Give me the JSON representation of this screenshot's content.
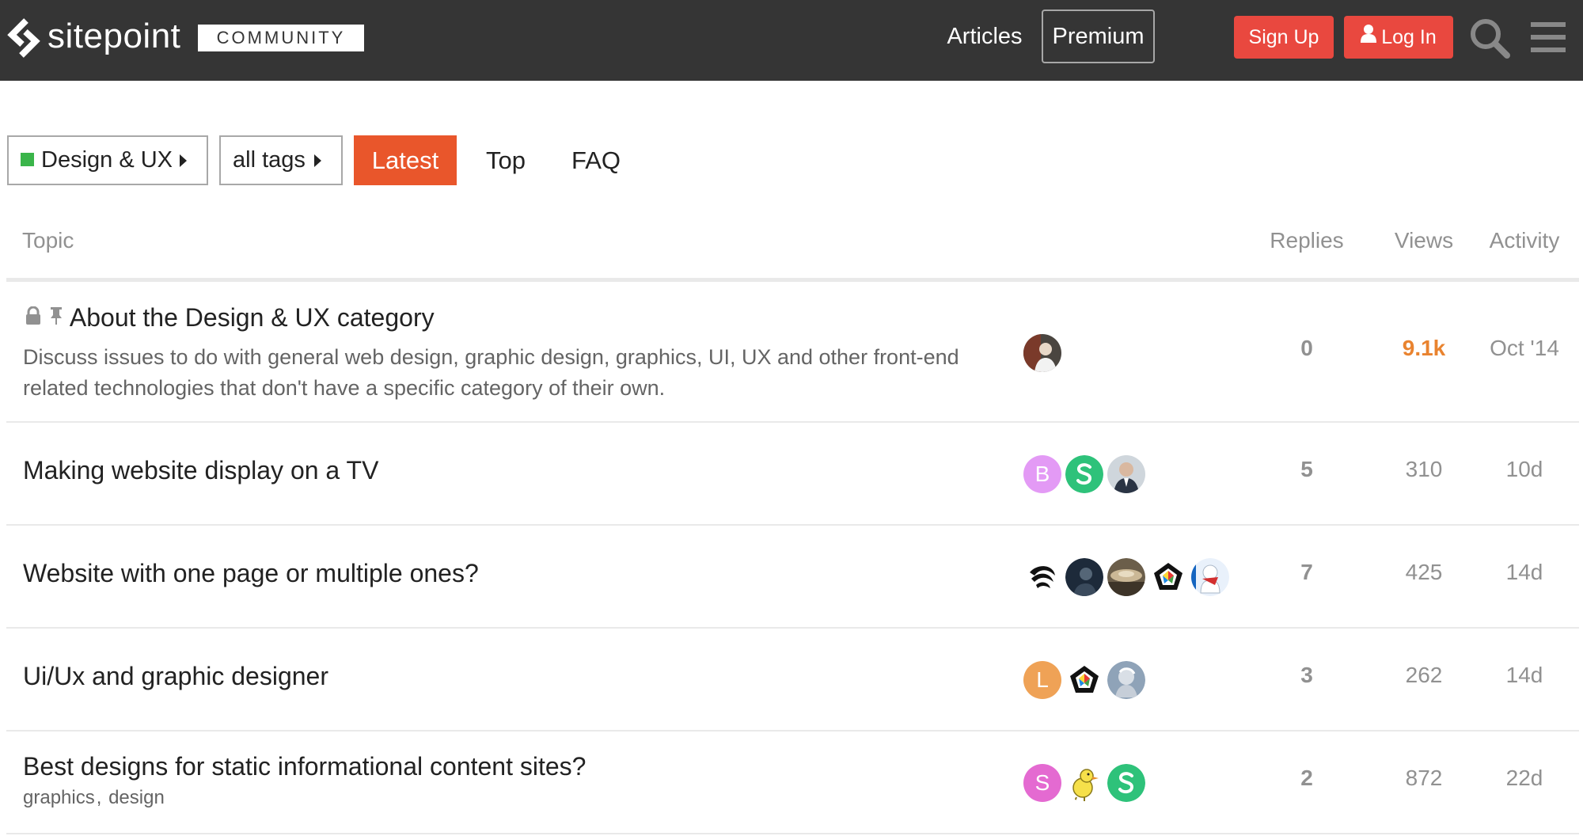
{
  "header": {
    "logo_text": "sitepoint",
    "community_label": "COMMUNITY",
    "nav": {
      "articles": "Articles",
      "premium": "Premium"
    },
    "signup_label": "Sign Up",
    "login_label": "Log In",
    "icons": [
      "logo-icon",
      "search-icon",
      "hamburger-menu-icon",
      "user-icon"
    ]
  },
  "filters": {
    "category": "Design & UX",
    "category_color": "#3ab54a",
    "tags": "all tags",
    "tabs": {
      "latest": "Latest",
      "top": "Top",
      "faq": "FAQ"
    }
  },
  "table": {
    "headers": {
      "topic": "Topic",
      "replies": "Replies",
      "views": "Views",
      "activity": "Activity"
    },
    "rows": [
      {
        "title": "About the Design & UX category",
        "excerpt": "Discuss issues to do with general web design, graphic design, graphics, UI, UX and other front-end related technologies that don't have a specific category of their own.",
        "status_icons": [
          "lock-icon",
          "pin-icon"
        ],
        "replies": "0",
        "views": "9.1k",
        "activity": "Oct '14"
      },
      {
        "title": "Making website display on a TV",
        "avatars": [
          {
            "letter": "B",
            "color": "#e39af5"
          },
          {
            "letter": "",
            "color": "#2ec27a"
          },
          {
            "letter": "",
            "color": "#2c3440"
          }
        ],
        "replies": "5",
        "views": "310",
        "activity": "10d"
      },
      {
        "title": "Website with one page or multiple ones?",
        "replies": "7",
        "views": "425",
        "activity": "14d"
      },
      {
        "title": "Ui/Ux and graphic designer",
        "avatars": [
          {
            "letter": "L",
            "color": "#efa256"
          }
        ],
        "replies": "3",
        "views": "262",
        "activity": "14d"
      },
      {
        "title": "Best designs for static informational content sites?",
        "tags": [
          "graphics",
          "design"
        ],
        "avatars": [
          {
            "letter": "S",
            "color": "#e46ad1"
          }
        ],
        "replies": "2",
        "views": "872",
        "activity": "22d"
      }
    ]
  },
  "colors": {
    "header_bg": "#353535",
    "accent_red": "#e9483f",
    "latest_tab": "#e9562b",
    "hot_views": "#e9832f"
  }
}
